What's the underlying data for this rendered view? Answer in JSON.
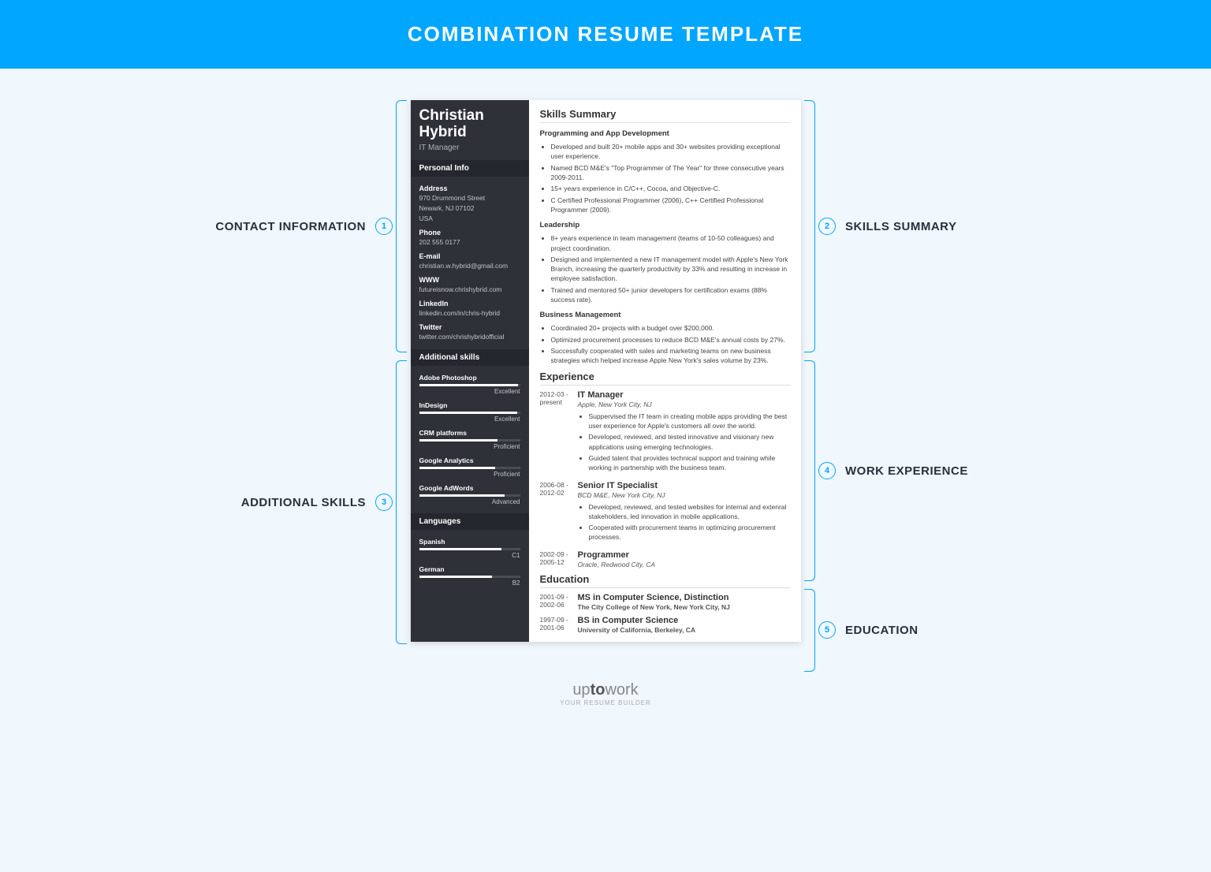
{
  "banner": "COMBINATION RESUME TEMPLATE",
  "callouts": {
    "c1": {
      "n": "1",
      "label": "CONTACT INFORMATION"
    },
    "c2": {
      "n": "2",
      "label": "SKILLS SUMMARY"
    },
    "c3": {
      "n": "3",
      "label": "ADDITIONAL SKILLS"
    },
    "c4": {
      "n": "4",
      "label": "WORK EXPERIENCE"
    },
    "c5": {
      "n": "5",
      "label": "EDUCATION"
    }
  },
  "name": "Christian Hybrid",
  "title": "IT Manager",
  "side": {
    "personal_h": "Personal Info",
    "addr_l": "Address",
    "addr_1": "970 Drummond Street",
    "addr_2": "Newark, NJ 07102",
    "addr_3": "USA",
    "phone_l": "Phone",
    "phone": "202 555 0177",
    "email_l": "E-mail",
    "email": "christian.w.hybrid@gmail.com",
    "www_l": "WWW",
    "www": "futureisnow.chrishybrid.com",
    "li_l": "LinkedIn",
    "li": "linkedin.com/in/chris-hybrid",
    "tw_l": "Twitter",
    "tw": "twitter.com/chrishybridofficial",
    "skills_h": "Additional skills",
    "s1": {
      "name": "Adobe Photoshop",
      "lvl": "Excellent",
      "w": "98%"
    },
    "s2": {
      "name": "InDesign",
      "lvl": "Excellent",
      "w": "97%"
    },
    "s3": {
      "name": "CRM platforms",
      "lvl": "Proficient",
      "w": "78%"
    },
    "s4": {
      "name": "Google Analytics",
      "lvl": "Proficient",
      "w": "75%"
    },
    "s5": {
      "name": "Google AdWords",
      "lvl": "Advanced",
      "w": "85%"
    },
    "lang_h": "Languages",
    "l1": {
      "name": "Spanish",
      "lvl": "C1",
      "w": "82%"
    },
    "l2": {
      "name": "German",
      "lvl": "B2",
      "w": "72%"
    }
  },
  "sec": {
    "skills": "Skills Summary",
    "exp": "Experience",
    "edu": "Education"
  },
  "sk": {
    "g1": "Programming and App Development",
    "g1i": [
      "Developed and built 20+ mobile apps and 30+ websites providing exceptional user experience.",
      "Named BCD M&E's \"Top Programmer of The Year\" for three consecutive years 2009-2011.",
      "15+ years experience in C/C++, Cocoa, and Objective-C.",
      "C Certified Professional Programmer (2006), C++ Certified Professional Programmer (2009)."
    ],
    "g2": "Leadership",
    "g2i": [
      "8+ years experience in team management (teams of 10-50 colleagues) and project coordination.",
      "Designed and implemented a new IT management model with Apple's New York Branch, increasing the quarterly productivity by 33% and resulting in increase in employee satisfaction.",
      "Trained and mentored 50+ junior developers for certification exams (88% success rate)."
    ],
    "g3": "Business Management",
    "g3i": [
      "Coordinated 20+ projects with a budget over $200,000.",
      "Optimized procurement processes to reduce BCD M&E's annual costs by 27%.",
      "Successfully cooperated with sales and marketing teams on new business strategies which helped increase Apple New York's sales volume by 23%."
    ]
  },
  "exp": {
    "e1": {
      "d1": "2012-03 -",
      "d2": "present",
      "t": "IT Manager",
      "c": "Apple, New York City, NJ",
      "b": [
        "Suppervised the IT team in creating mobile apps providing the best user experience for Apple's customers all over the world.",
        "Developed, reviewed, and tested innovative and visionary new applications using emerging technologies.",
        "Guided talent that provides technical support and training while working in partnership with the business team."
      ]
    },
    "e2": {
      "d1": "2006-08 -",
      "d2": "2012-02",
      "t": "Senior IT Specialist",
      "c": "BCD M&E, New York City, NJ",
      "b": [
        "Developed, reviewed, and tested websites for internal and extenral stakeholders, led innovation in mobile applications.",
        "Cooperated with procurement teams in optimizing procurement processes."
      ]
    },
    "e3": {
      "d1": "2002-09 -",
      "d2": "2005-12",
      "t": "Programmer",
      "c": "Oracle, Redwood City, CA"
    }
  },
  "edu": {
    "e1": {
      "d1": "2001-09 -",
      "d2": "2002-06",
      "t": "MS in Computer Science, Distinction",
      "c": "The City College of New York, New York City, NJ"
    },
    "e2": {
      "d1": "1997-09 -",
      "d2": "2001-06",
      "t": "BS in Computer Science",
      "c": "University of California, Berkeley, CA"
    }
  },
  "footer": {
    "brand1": "up",
    "brand2": "to",
    "brand3": "work",
    "tag": "YOUR RESUME BUILDER"
  }
}
